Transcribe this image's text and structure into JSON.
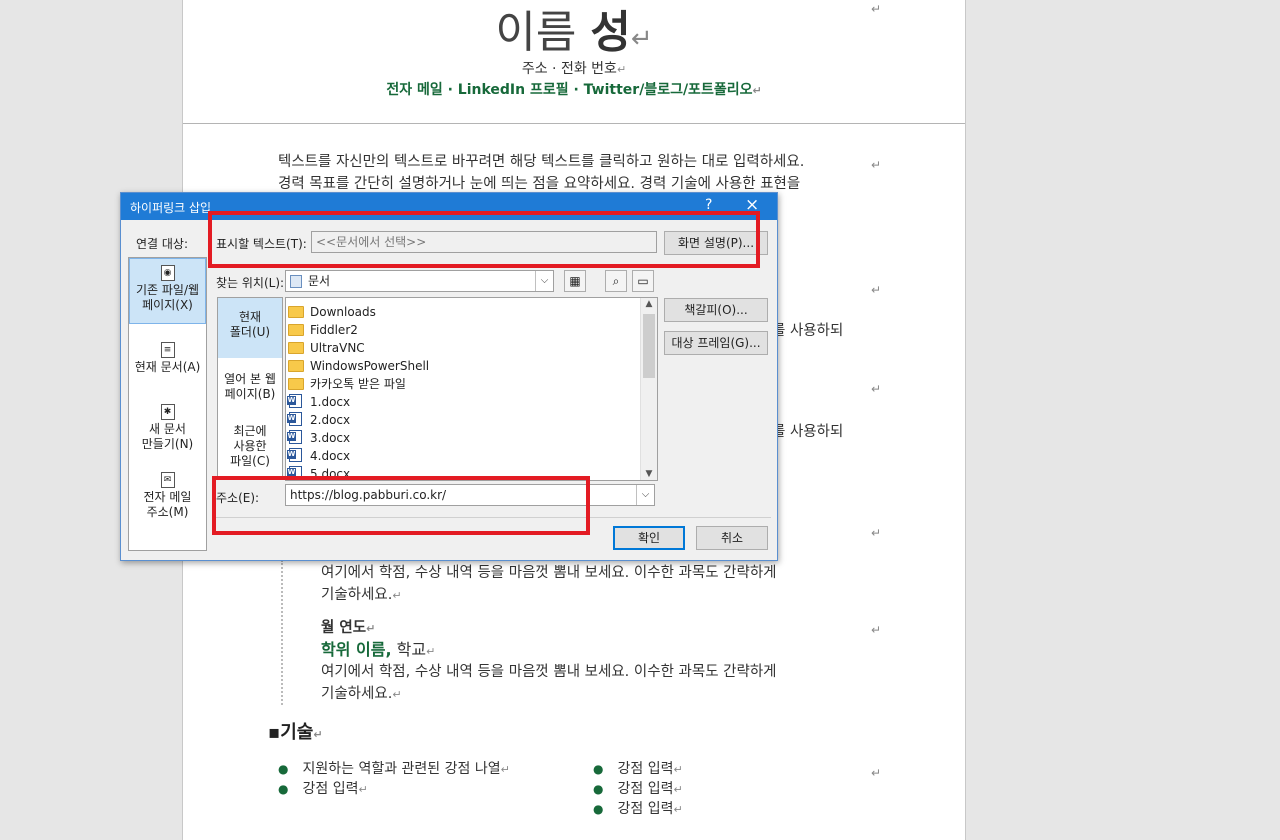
{
  "document": {
    "name_light": "이름",
    "name_bold": "성",
    "address_line": "주소 · 전화 번호",
    "contact_line": "전자 메일 · LinkedIn 프로필 · Twitter/블로그/포트폴리오",
    "para1_line1": "텍스트를 자신만의 텍스트로 바꾸려면 해당 텍스트를 클릭하고 원하는 대로 입력하세요.",
    "para1_line2": "경력 목표를 간단히 설명하거나 눈에 띄는 점을 요약하세요. 경력 기술에 사용한 표현을",
    "frag1": "를 사용하되",
    "frag2": "를 사용하되",
    "edu1_desc_line1": "여기에서 학점, 수상 내역 등을 마음껏 뽐내 보세요. 이수한 과목도 간략하게",
    "edu1_desc_line2": "기술하세요.",
    "edu2_date": "월 연도",
    "edu2_degree": "학위 이름,",
    "edu2_school": " 학교",
    "edu2_desc_line1": "여기에서 학점, 수상 내역 등을 마음껏 뽐내 보세요. 이수한 과목도 간략하게",
    "edu2_desc_line2": "기술하세요.",
    "skills_heading": "▪기술",
    "skills_left": [
      "지원하는 역할과 관련된 강점 나열",
      "강점 입력"
    ],
    "skills_right": [
      "강점 입력",
      "강점 입력",
      "강점 입력"
    ],
    "para_mark": "↵"
  },
  "dialog": {
    "title": "하이퍼링크 삽입",
    "help": "?",
    "close": "×",
    "link_to_label": "연결 대상:",
    "link_targets": [
      {
        "label1": "기존 파일/웹",
        "label2": "페이지(X)"
      },
      {
        "label1": "현재 문서(A)",
        "label2": ""
      },
      {
        "label1": "새 문서",
        "label2": "만들기(N)"
      },
      {
        "label1": "전자 메일",
        "label2": "주소(M)"
      }
    ],
    "display_text_label": "표시할 텍스트(T):",
    "display_text_value": "<<문서에서 선택>>",
    "screentip_button": "화면 설명(P)...",
    "look_in_label": "찾는 위치(L):",
    "look_in_value": "문서",
    "places": [
      {
        "l1": "현재",
        "l2": "폴더(U)",
        "l3": ""
      },
      {
        "l1": "열어 본 웹",
        "l2": "페이지(B)",
        "l3": ""
      },
      {
        "l1": "최근에",
        "l2": "사용한",
        "l3": "파일(C)"
      }
    ],
    "files": [
      "Downloads",
      "Fiddler2",
      "UltraVNC",
      "WindowsPowerShell",
      "카카오톡 받은 파일",
      "1.docx",
      "2.docx",
      "3.docx",
      "4.docx",
      "5.docx"
    ],
    "file_types": [
      "folder",
      "folder",
      "folder",
      "folder",
      "folder",
      "word",
      "word",
      "word",
      "word",
      "word"
    ],
    "bookmark_button": "책갈피(O)...",
    "target_frame_button": "대상 프레임(G)...",
    "address_label": "주소(E):",
    "address_value": "https://blog.pabburi.co.kr/",
    "ok_button": "확인",
    "cancel_button": "취소"
  },
  "colors": {
    "accent_green": "#17693a",
    "titlebar_blue": "#1f7bd6",
    "highlight_red": "#e31b23"
  }
}
